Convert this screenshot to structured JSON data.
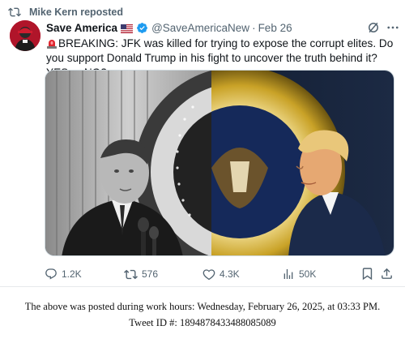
{
  "repost": {
    "text": "Mike Kern reposted"
  },
  "author": {
    "name": "Save America",
    "flag_icon": "us-flag-icon",
    "verified_icon": "verified-badge-icon",
    "handle": "@SaveAmericaNew",
    "separator": "·",
    "date": "Feb 26"
  },
  "tweet": {
    "siren_icon": "siren-emoji-icon",
    "text": "BREAKING: JFK was killed for trying to expose the corrupt elites. Do you support Donald Trump in his fight to uncover the truth behind it? YES or NO?"
  },
  "actions": {
    "replies": "1.2K",
    "reposts": "576",
    "likes": "4.3K",
    "views": "50K"
  },
  "footer": {
    "line1": "The above was posted during work hours: Wednesday, February 26, 2025, at 03:33 PM.",
    "line2": "Tweet ID #: 1894878433488085089"
  },
  "colors": {
    "muted": "#536471",
    "verified": "#1d9bf0",
    "seal_gold": "#c9a227"
  }
}
